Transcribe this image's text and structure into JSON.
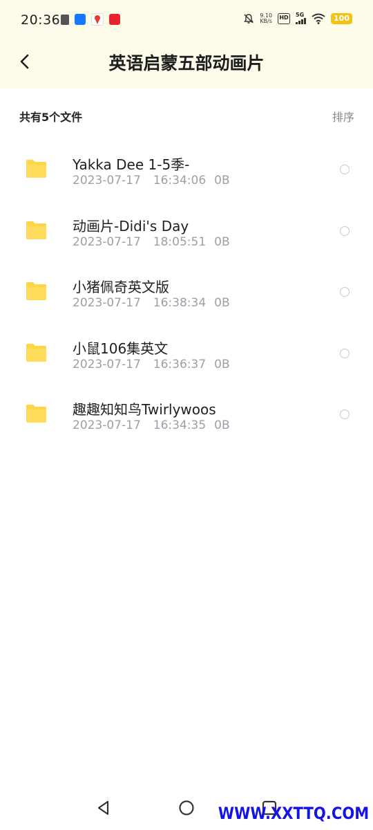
{
  "status_bar": {
    "time": "20:36",
    "net_speed_value": "9.10",
    "net_speed_unit": "KB/s",
    "hd_label": "HD",
    "network_type": "5G",
    "battery_level": "100",
    "battery_color": "#f3c213"
  },
  "header": {
    "title": "英语启蒙五部动画片",
    "back_icon": "chevron-left-icon"
  },
  "subheader": {
    "file_count": "共有5个文件",
    "sort_label": "排序"
  },
  "files": [
    {
      "name": "Yakka  Dee  1-5季-",
      "date": "2023-07-17",
      "time": "16:34:06",
      "size": "0B"
    },
    {
      "name": "动画片-Didi's  Day",
      "date": "2023-07-17",
      "time": "18:05:51",
      "size": "0B"
    },
    {
      "name": "小猪佩奇英文版",
      "date": "2023-07-17",
      "time": "16:38:34",
      "size": "0B"
    },
    {
      "name": "小鼠106集英文",
      "date": "2023-07-17",
      "time": "16:36:37",
      "size": "0B"
    },
    {
      "name": "趣趣知知鸟Twirlywoos",
      "date": "2023-07-17",
      "time": "16:34:35",
      "size": "0B"
    }
  ],
  "colors": {
    "header_bg": "#fdfbe9",
    "folder": "#fdd648",
    "meta_text": "#9aa0a8",
    "watermark": "#1414e6"
  },
  "watermark": "WWW.XXTTQ.COM"
}
